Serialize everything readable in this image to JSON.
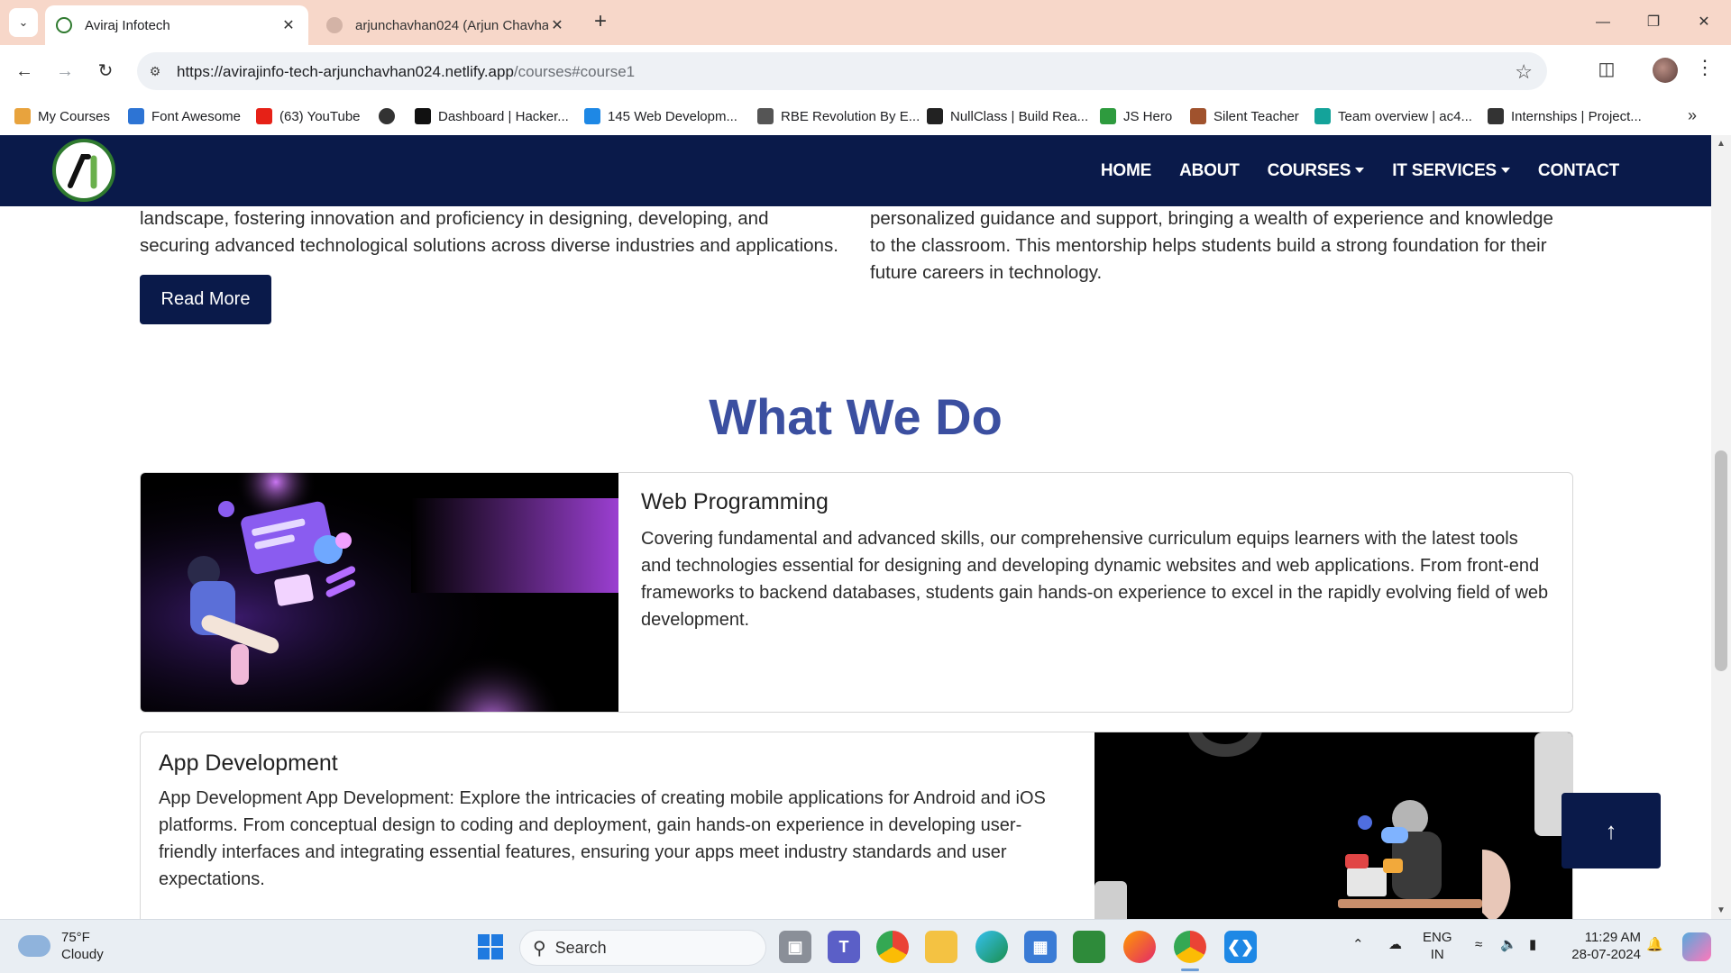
{
  "browser": {
    "tabs": [
      {
        "title": "Aviraj Infotech",
        "active": true
      },
      {
        "title": "arjunchavhan024 (Arjun Chavha",
        "active": false
      }
    ],
    "url_host": "https://avirajinfo-tech-arjunchavhan024.netlify.app",
    "url_path": "/courses#course1",
    "bookmarks": [
      {
        "label": "My Courses",
        "icon": "crown-icon",
        "color": "#e8a33d"
      },
      {
        "label": "Font Awesome",
        "icon": "flag-icon",
        "color": "#2d74d4"
      },
      {
        "label": "(63) YouTube",
        "icon": "youtube-icon",
        "color": "#e62117"
      },
      {
        "label": "",
        "icon": "globe-icon",
        "color": "#333333"
      },
      {
        "label": "Dashboard | Hacker...",
        "icon": "hackerrank-icon",
        "color": "#111111"
      },
      {
        "label": "145 Web Developm...",
        "icon": "js-icon",
        "color": "#1e88e5"
      },
      {
        "label": "RBE Revolution By E...",
        "icon": "chart-icon",
        "color": "#555555"
      },
      {
        "label": "NullClass | Build Rea...",
        "icon": "nullclass-icon",
        "color": "#222222"
      },
      {
        "label": "JS Hero",
        "icon": "jshero-icon",
        "color": "#2e9b3e"
      },
      {
        "label": "Silent Teacher",
        "icon": "silent-teacher-icon",
        "color": "#a0522d"
      },
      {
        "label": "Team overview | ac4...",
        "icon": "diamond-icon",
        "color": "#14a39a"
      },
      {
        "label": "Internships | Project...",
        "icon": "compass-icon",
        "color": "#333333"
      }
    ]
  },
  "site": {
    "nav": [
      "HOME",
      "ABOUT",
      "COURSES",
      "IT SERVICES",
      "CONTACT"
    ],
    "left_paragraph": "landscape, fostering innovation and proficiency in designing, developing, and securing advanced technological solutions across diverse industries and applications.",
    "right_paragraph": "personalized guidance and support, bringing a wealth of experience and knowledge to the classroom. This mentorship helps students build a strong foundation for their future careers in technology.",
    "read_more": "Read More",
    "section_title": "What We Do",
    "cards": [
      {
        "title": "Web Programming",
        "text": "Covering fundamental and advanced skills, our comprehensive curriculum equips learners with the latest tools and technologies essential for designing and developing dynamic websites and web applications. From front-end frameworks to backend databases, students gain hands-on experience to excel in the rapidly evolving field of web development."
      },
      {
        "title": "App Development",
        "text": "App Development App Development: Explore the intricacies of creating mobile applications for Android and iOS platforms. From conceptual design to coding and deployment, gain hands-on experience in developing user-friendly interfaces and integrating essential features, ensuring your apps meet industry standards and user expectations."
      }
    ]
  },
  "taskbar": {
    "weather_temp": "75°F",
    "weather_desc": "Cloudy",
    "search": "Search",
    "lang": "ENG",
    "region": "IN",
    "time": "11:29 AM",
    "date": "28-07-2024"
  },
  "colors": {
    "site_navy": "#0a1a4a",
    "title_blue": "#3b4fa0",
    "tabstrip": "#f7d7c9"
  }
}
